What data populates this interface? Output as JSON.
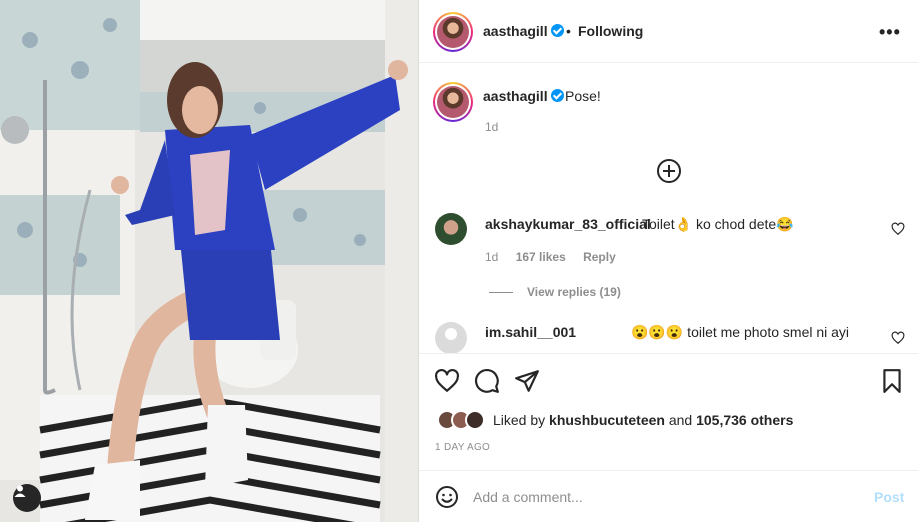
{
  "post": {
    "username": "aasthagill",
    "follow_state": "Following",
    "separator": "•",
    "more_label": "•••",
    "caption": "Pose!",
    "caption_time": "1d"
  },
  "comments": [
    {
      "username": "akshaykumar_83_official",
      "text": "Toilet👌 ko chod dete😂",
      "time": "1d",
      "likes": "167 likes",
      "reply_label": "Reply",
      "view_replies": "View replies (19)"
    },
    {
      "username": "im.sahil__001",
      "text": "😮😮😮 toilet me photo smel ni ayi"
    }
  ],
  "engagement": {
    "liked_by_prefix": "Liked by",
    "liked_by_user": "khushbucuteteen",
    "liked_by_and": "and",
    "others": "105,736 others",
    "timestamp": "1 DAY AGO"
  },
  "composer": {
    "placeholder": "Add a comment...",
    "post_label": "Post"
  },
  "icons": {
    "like": "heart-icon",
    "comment": "comment-icon",
    "share": "send-icon",
    "save": "bookmark-icon",
    "emoji": "emoji-icon",
    "more": "more-icon",
    "verified": "verified-badge-icon",
    "tag": "user-tag-icon"
  },
  "colors": {
    "verified_blue": "#0095f6",
    "post_disabled": "#b2dffc",
    "muted_text": "#8e8e8e"
  }
}
